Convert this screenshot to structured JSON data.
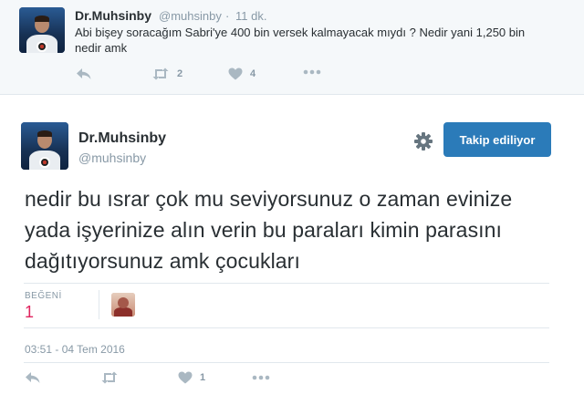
{
  "parent_tweet": {
    "name": "Dr.Muhsinby",
    "handle": "@muhsinby",
    "separator": "·",
    "time": "11 dk.",
    "text": "Abi bişey soracağım Sabri'ye 400 bin versek kalmayacak mıydı ? Nedir yani 1,250 bin nedir amk",
    "retweets": "2",
    "likes": "4"
  },
  "main_tweet": {
    "name": "Dr.Muhsinby",
    "handle": "@muhsinby",
    "follow_button": "Takip ediliyor",
    "text": "nedir bu ısrar çok mu seviyorsunuz o zaman evinize yada işyerinize alın verin bu paraları kimin parasını dağıtıyorsunuz amk çocukları",
    "likes_label": "BEĞENİ",
    "likes_count": "1",
    "timestamp": "03:51 - 04 Tem 2016",
    "action_likes": "1"
  },
  "colors": {
    "accent": "#2b7bb9",
    "like_red": "#e0245e",
    "muted": "#8899a6",
    "icon": "#aab8c2"
  },
  "icons": [
    "reply-icon",
    "retweet-icon",
    "heart-icon",
    "more-icon",
    "gear-icon"
  ]
}
